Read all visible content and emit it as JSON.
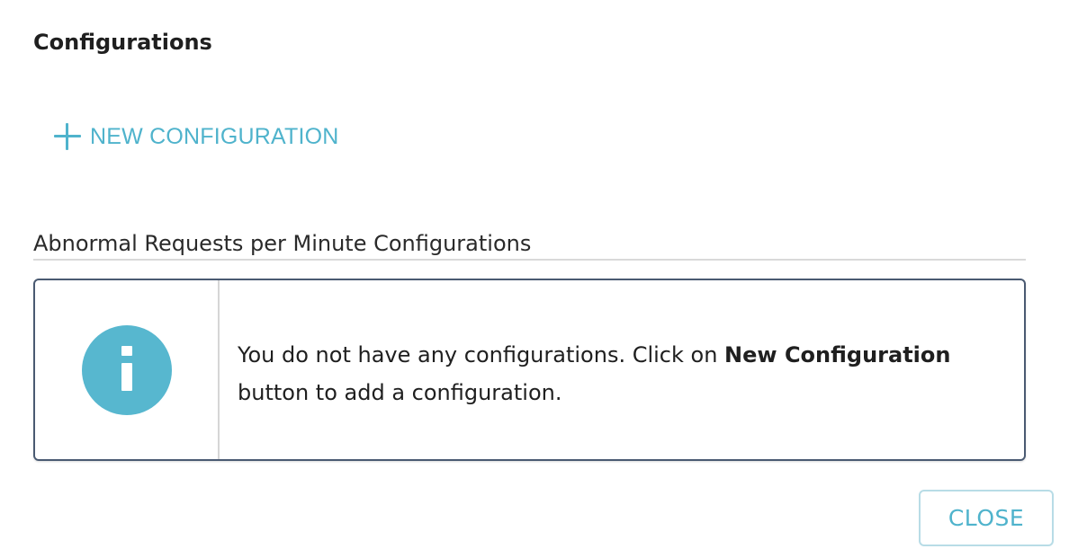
{
  "dialog": {
    "title": "Configurations",
    "new_configuration_label": "NEW CONFIGURATION",
    "section_title": "Abnormal Requests per Minute Configurations",
    "empty_state": {
      "icon": "info-icon",
      "message_prefix": "You do not have any configurations. Click on ",
      "message_emphasis": "New Configuration",
      "message_suffix": " button to add a configuration."
    },
    "close_label": "CLOSE"
  },
  "colors": {
    "accent": "#4fb3cc",
    "info_icon": "#57b7cf",
    "panel_border": "#4a5a72",
    "close_border": "#b8dce6"
  }
}
